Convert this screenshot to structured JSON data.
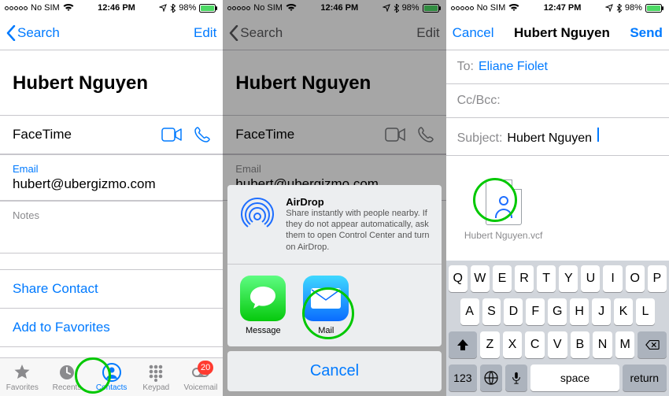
{
  "status": {
    "carrier": "No SIM",
    "wifi_icon": "wifi",
    "time1": "12:46 PM",
    "time2": "12:46 PM",
    "time3": "12:47 PM",
    "battery_text": "98%"
  },
  "colors": {
    "accent": "#007aff",
    "green_ring": "#00c800",
    "badge": "#ff3b30"
  },
  "screen1": {
    "back_label": "Search",
    "edit_label": "Edit",
    "contact_name": "Hubert Nguyen",
    "facetime_label": "FaceTime",
    "email_label": "Email",
    "email_value": "hubert@ubergizmo.com",
    "notes_label": "Notes",
    "share_label": "Share Contact",
    "fav_label": "Add to Favorites",
    "tabs": {
      "favorites": "Favorites",
      "recents": "Recents",
      "contacts": "Contacts",
      "keypad": "Keypad",
      "voicemail": "Voicemail",
      "voicemail_badge": "20"
    }
  },
  "screen2": {
    "back_label": "Search",
    "edit_label": "Edit",
    "contact_name": "Hubert Nguyen",
    "facetime_label": "FaceTime",
    "email_label": "Email",
    "email_value": "hubert@ubergizmo.com",
    "airdrop_title": "AirDrop",
    "airdrop_desc": "Share instantly with people nearby. If they do not appear automatically, ask them to open Control Center and turn on AirDrop.",
    "apps": {
      "message": "Message",
      "mail": "Mail"
    },
    "cancel": "Cancel"
  },
  "screen3": {
    "cancel": "Cancel",
    "title": "Hubert Nguyen",
    "send": "Send",
    "to_label": "To:",
    "to_value": "Eliane Fiolet",
    "ccbcc_label": "Cc/Bcc:",
    "subject_label": "Subject:",
    "subject_value": "Hubert Nguyen",
    "attachment_name": "Hubert Nguyen.vcf",
    "keyboard": {
      "row1": [
        "Q",
        "W",
        "E",
        "R",
        "T",
        "Y",
        "U",
        "I",
        "O",
        "P"
      ],
      "row2": [
        "A",
        "S",
        "D",
        "F",
        "G",
        "H",
        "J",
        "K",
        "L"
      ],
      "row3": [
        "Z",
        "X",
        "C",
        "V",
        "B",
        "N",
        "M"
      ],
      "numKey": "123",
      "space": "space",
      "return": "return"
    }
  }
}
